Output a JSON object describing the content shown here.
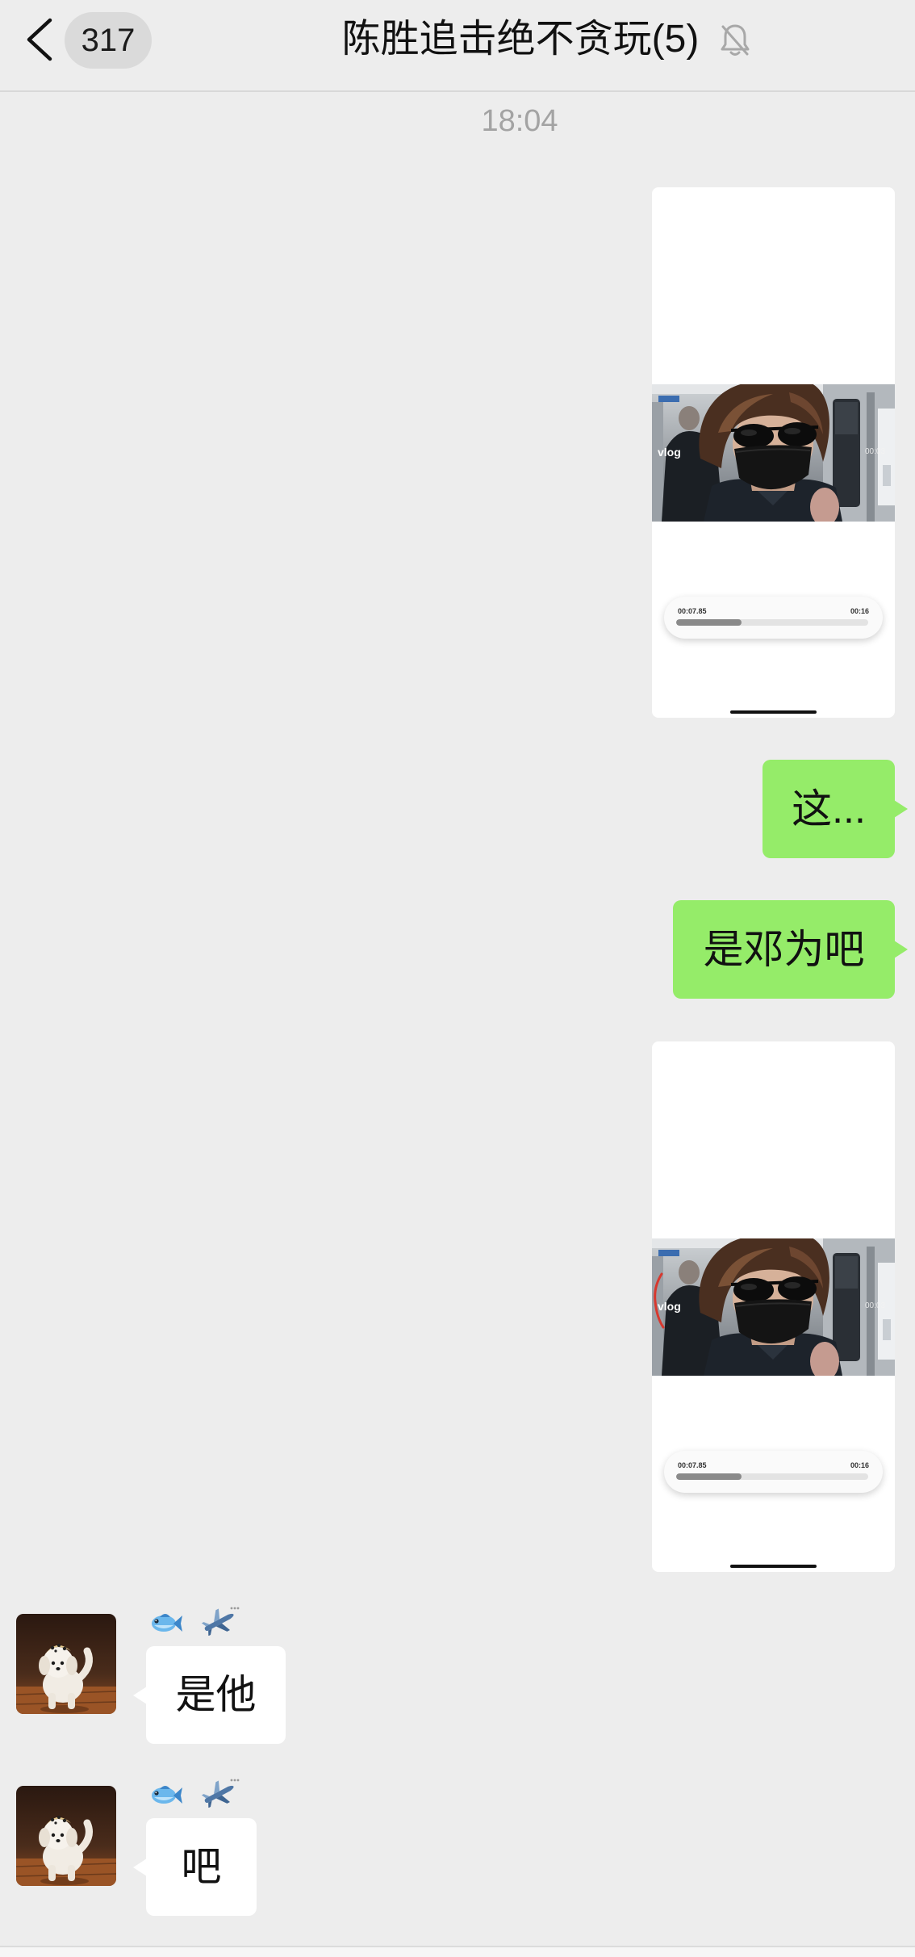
{
  "header": {
    "back_icon": "chevron-left-icon",
    "unread_count": "317",
    "title": "陈胜追击绝不贪玩(5)",
    "muted_icon": "bell-slash-icon"
  },
  "colors": {
    "background": "#EDEDED",
    "sent_bubble": "#95EC69",
    "received_bubble": "#FFFFFF",
    "timestamp_text": "#A3A3A3",
    "unread_badge": "#DADADA"
  },
  "timestamp": "18:04",
  "messages": [
    {
      "direction": "sent",
      "type": "image",
      "image": {
        "overlay_left": "vlog",
        "overlay_right": "00:03",
        "player_elapsed": "00:07.85",
        "player_duration": "00:16",
        "player_progress": 0.34
      }
    },
    {
      "direction": "sent",
      "type": "text",
      "text": "这..."
    },
    {
      "direction": "sent",
      "type": "text",
      "text": "是邓为吧"
    },
    {
      "direction": "sent",
      "type": "image",
      "image": {
        "overlay_left": "vlog",
        "overlay_right": "00:03",
        "player_elapsed": "00:07.85",
        "player_duration": "00:16",
        "player_progress": 0.34
      }
    },
    {
      "direction": "received",
      "type": "text",
      "avatar": "dog-avatar",
      "sender_icons": [
        "fish-icon",
        "airplane-icon"
      ],
      "text": "是他"
    },
    {
      "direction": "received",
      "type": "text",
      "avatar": "dog-avatar",
      "sender_icons": [
        "fish-icon",
        "airplane-icon"
      ],
      "text": "吧"
    }
  ]
}
